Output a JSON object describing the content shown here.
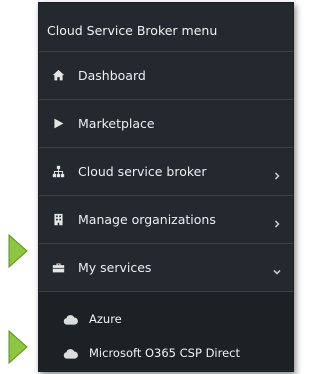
{
  "menu": {
    "title": "Cloud Service Broker menu",
    "items": [
      {
        "label": "Dashboard",
        "icon": "home-icon",
        "chevron": ""
      },
      {
        "label": "Marketplace",
        "icon": "play-icon",
        "chevron": ""
      },
      {
        "label": "Cloud service broker",
        "icon": "sitemap-icon",
        "chevron": "right"
      },
      {
        "label": "Manage organizations",
        "icon": "building-icon",
        "chevron": "right"
      },
      {
        "label": "My services",
        "icon": "briefcase-icon",
        "chevron": "down"
      }
    ],
    "subitems": [
      {
        "label": "Azure",
        "icon": "cloud-icon"
      },
      {
        "label": "Microsoft O365 CSP Direct",
        "icon": "cloud-icon"
      }
    ]
  },
  "colors": {
    "menu_bg": "#23292e",
    "submenu_bg": "#1c2125",
    "pointer_arrow": "#8dc63f"
  }
}
